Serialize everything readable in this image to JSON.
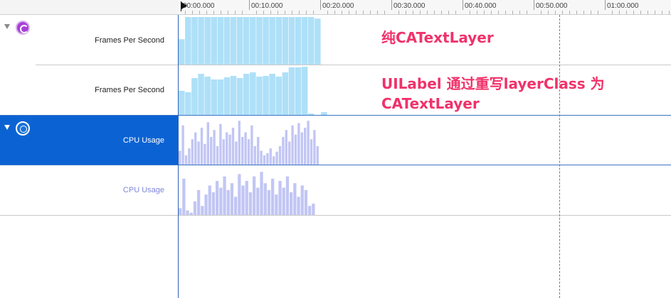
{
  "timeline": {
    "ticks": [
      "00:00.000",
      "00:10.000",
      "00:20.000",
      "00:30.000",
      "00:40.000",
      "00:50.000",
      "01:00.000"
    ]
  },
  "tracks": {
    "fps_1_label": "Frames Per Second",
    "fps_2_label": "Frames Per Second",
    "cpu_1_label": "CPU Usage",
    "cpu_2_label": "CPU Usage"
  },
  "annotations": {
    "first": "纯CATextLayer",
    "second_line1": "UILabel 通过重写layerClass 为",
    "second_line2": "CATextLayer"
  },
  "icons": {
    "fps_instrument": "core-animation-icon",
    "cpu_instrument": "activity-monitor-icon",
    "playhead": "playhead-flag-icon"
  },
  "colors": {
    "fps_bar": "#aee0f8",
    "cpu_bar": "#c2c6f4",
    "selection": "#0b63d3",
    "annotation": "#f0326a"
  },
  "chart_data": [
    {
      "type": "bar",
      "series": [
        {
          "values": [
            32,
            60,
            60,
            60,
            60,
            60,
            60,
            60,
            60,
            60,
            60,
            60,
            60,
            60,
            60,
            60,
            60,
            60,
            60,
            60,
            60,
            58
          ]
        }
      ],
      "ylim": [
        0,
        60
      ]
    },
    {
      "type": "bar",
      "series": [
        {
          "values": [
            34,
            32,
            52,
            58,
            54,
            50,
            50,
            53,
            55,
            52,
            58,
            60,
            54,
            55,
            58,
            54,
            60,
            67,
            67,
            68,
            2,
            0,
            4
          ]
        }
      ],
      "ylim": [
        0,
        68
      ]
    },
    {
      "type": "bar",
      "series": [
        {
          "values": [
            30,
            85,
            20,
            35,
            55,
            70,
            50,
            80,
            45,
            92,
            60,
            75,
            40,
            88,
            55,
            70,
            65,
            80,
            50,
            95,
            60,
            70,
            55,
            85,
            40,
            60,
            30,
            20,
            25,
            35,
            18,
            28,
            40,
            60,
            75,
            50,
            85,
            65,
            90,
            70,
            80,
            95,
            55,
            75,
            40
          ]
        }
      ],
      "ylim": [
        0,
        100
      ]
    },
    {
      "type": "bar",
      "series": [
        {
          "values": [
            15,
            80,
            10,
            5,
            30,
            55,
            20,
            45,
            65,
            50,
            75,
            60,
            85,
            55,
            70,
            40,
            90,
            65,
            75,
            50,
            85,
            60,
            95,
            70,
            55,
            80,
            45,
            75,
            60,
            85,
            50,
            70,
            40,
            65,
            55,
            20,
            25
          ]
        }
      ],
      "ylim": [
        0,
        100
      ]
    }
  ]
}
